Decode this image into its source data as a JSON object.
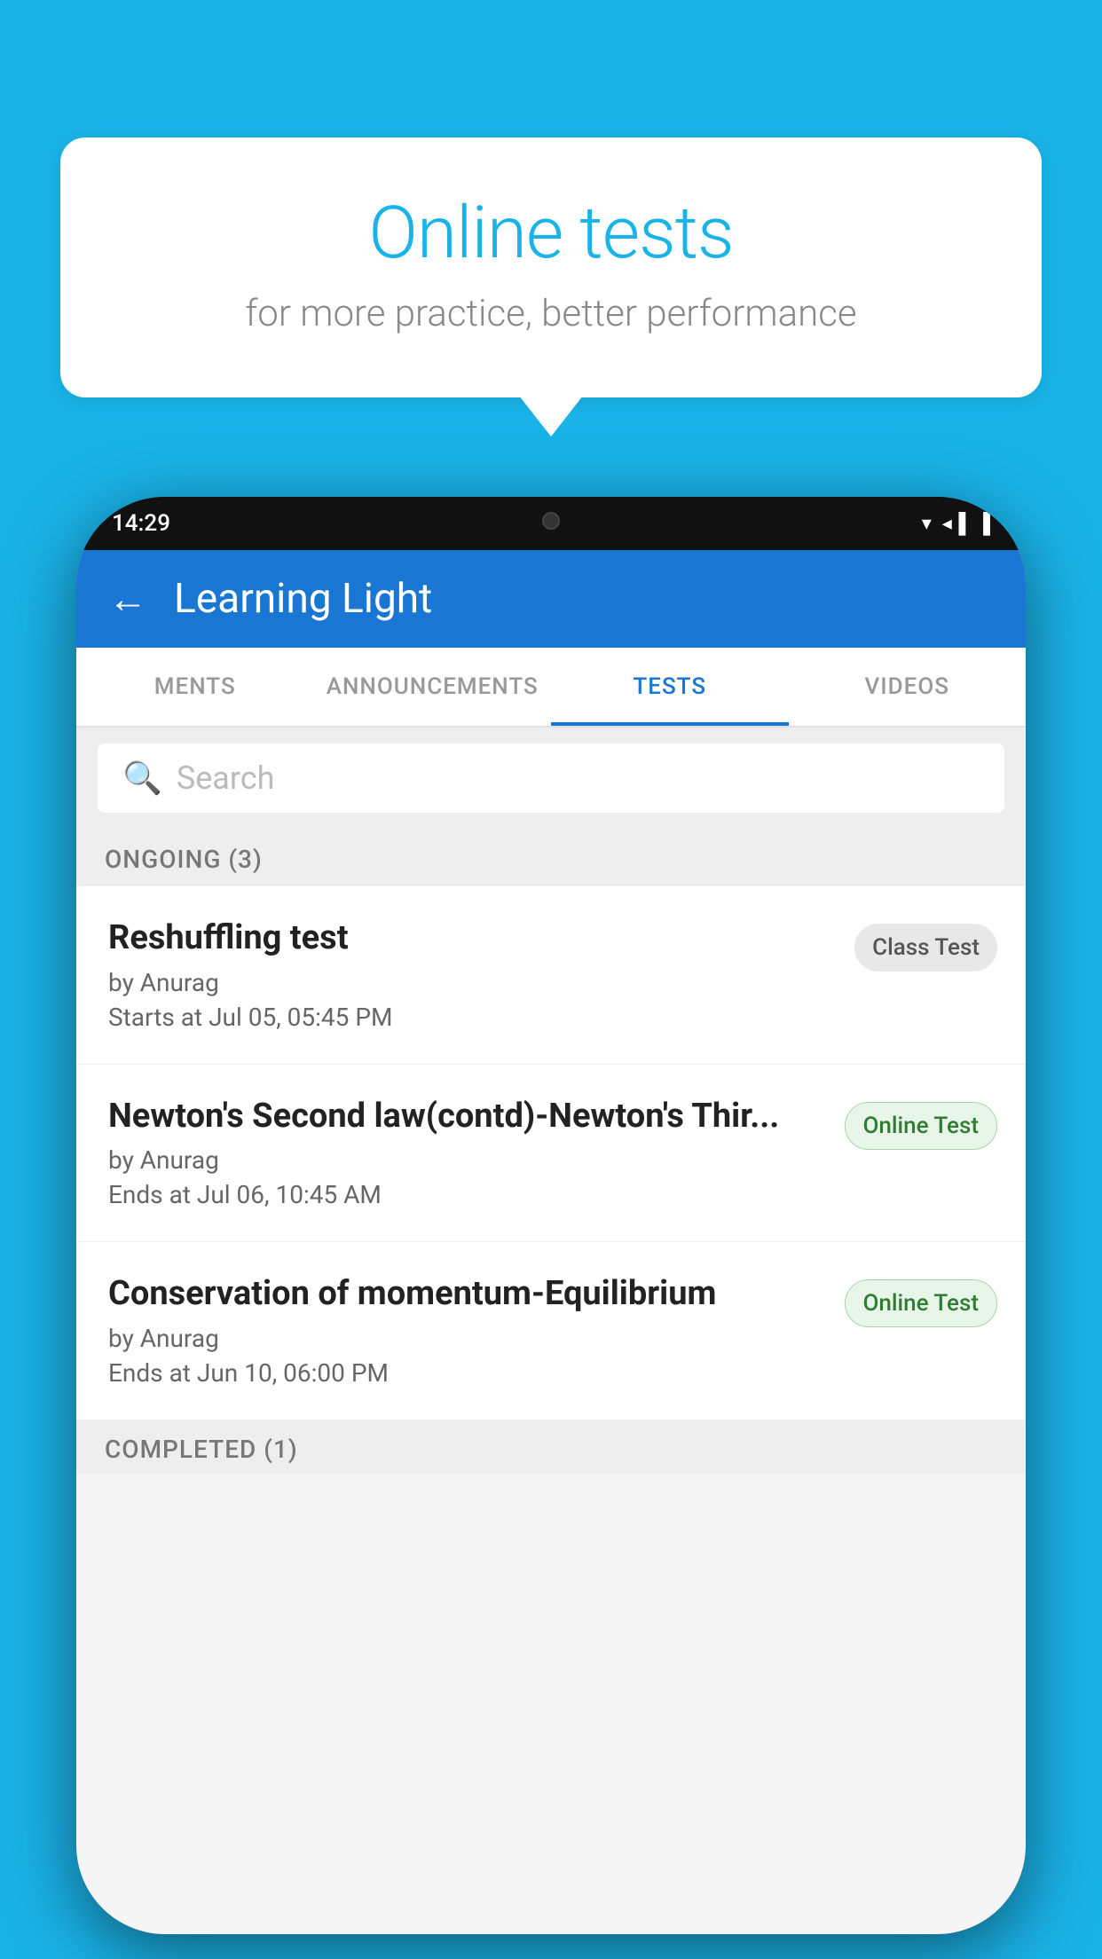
{
  "background_color": "#1ab3e8",
  "bubble": {
    "title": "Online tests",
    "subtitle": "for more practice, better performance"
  },
  "phone": {
    "status_bar": {
      "time": "14:29",
      "icons": "▾◂▐"
    },
    "app_bar": {
      "title": "Learning Light",
      "back_label": "←"
    },
    "tabs": [
      {
        "label": "MENTS",
        "active": false
      },
      {
        "label": "ANNOUNCEMENTS",
        "active": false
      },
      {
        "label": "TESTS",
        "active": true
      },
      {
        "label": "VIDEOS",
        "active": false
      }
    ],
    "search": {
      "placeholder": "Search"
    },
    "ongoing_section": {
      "title": "ONGOING (3)",
      "tests": [
        {
          "name": "Reshuffling test",
          "by": "by Anurag",
          "time_label": "Starts at",
          "time": "Jul 05, 05:45 PM",
          "badge": "Class Test",
          "badge_type": "class"
        },
        {
          "name": "Newton's Second law(contd)-Newton's Thir...",
          "by": "by Anurag",
          "time_label": "Ends at",
          "time": "Jul 06, 10:45 AM",
          "badge": "Online Test",
          "badge_type": "online"
        },
        {
          "name": "Conservation of momentum-Equilibrium",
          "by": "by Anurag",
          "time_label": "Ends at",
          "time": "Jun 10, 06:00 PM",
          "badge": "Online Test",
          "badge_type": "online"
        }
      ]
    },
    "completed_section": {
      "title": "COMPLETED (1)"
    }
  }
}
